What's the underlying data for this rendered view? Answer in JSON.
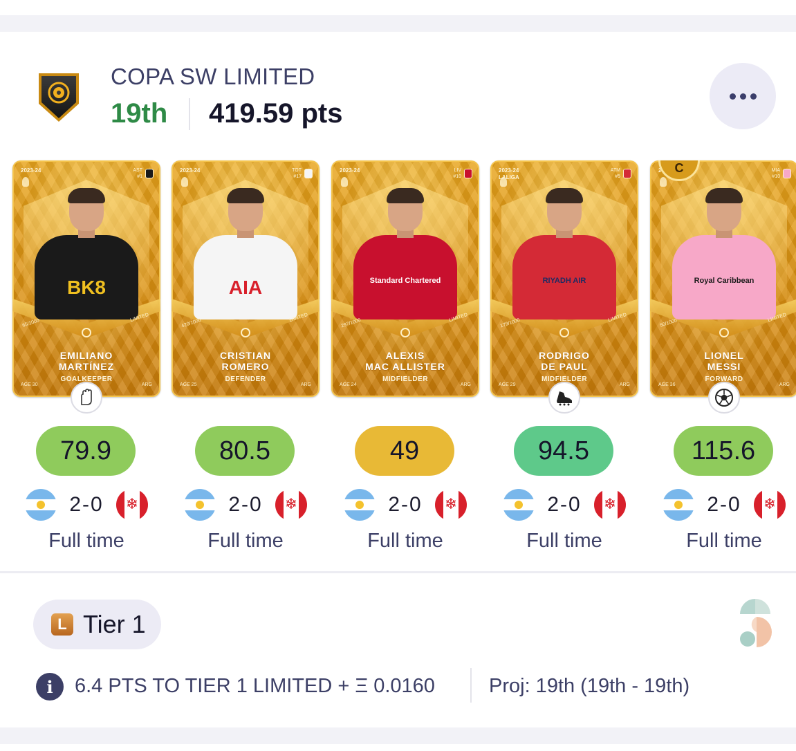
{
  "competition": {
    "title": "COPA SW LIMITED",
    "rank": "19th",
    "points": "419.59 pts",
    "more_icon": "ellipsis-icon"
  },
  "players": [
    {
      "season": "2023-24",
      "club_code": "AST",
      "club_number": "#1",
      "name_line1": "EMILIANO",
      "name_line2": "MARTÍNEZ",
      "position": "GOALKEEPER",
      "age": "AGE 30",
      "nationality": "ARG",
      "serial": "65/1000",
      "rarity": "LIMITED",
      "sponsor": "BK8",
      "shirt_color": "#1a1a1a",
      "sponsor_color": "#f0c020",
      "position_icon": "goalkeeper-gloves-icon",
      "captain": false,
      "score": "79.9",
      "score_color": "#8fcb5c",
      "home_score": "2",
      "away_score": "0",
      "status": "Full time"
    },
    {
      "season": "2023-24",
      "club_code": "TOT",
      "club_number": "#17",
      "name_line1": "CRISTIAN",
      "name_line2": "ROMERO",
      "position": "DEFENDER",
      "age": "AGE 25",
      "nationality": "ARG",
      "serial": "420/1000",
      "rarity": "LIMITED",
      "sponsor": "AIA",
      "shirt_color": "#f5f5f5",
      "sponsor_color": "#d8202b",
      "position_icon": "",
      "captain": false,
      "score": "80.5",
      "score_color": "#8fcb5c",
      "home_score": "2",
      "away_score": "0",
      "status": "Full time"
    },
    {
      "season": "2023-24",
      "club_code": "LIV",
      "club_number": "#10",
      "name_line1": "ALEXIS",
      "name_line2": "MAC ALLISTER",
      "position": "MIDFIELDER",
      "age": "AGE 24",
      "nationality": "ARG",
      "serial": "297/1000",
      "rarity": "LIMITED",
      "sponsor": "Standard Chartered",
      "shirt_color": "#c8102e",
      "sponsor_color": "#ffffff",
      "position_icon": "",
      "captain": false,
      "score": "49",
      "score_color": "#e8b936",
      "home_score": "2",
      "away_score": "0",
      "status": "Full time"
    },
    {
      "season": "2023-24",
      "league": "LALIGA",
      "club_code": "ATM",
      "club_number": "#5",
      "name_line1": "RODRIGO",
      "name_line2": "DE PAUL",
      "position": "MIDFIELDER",
      "age": "AGE 29",
      "nationality": "ARG",
      "serial": "179/1000",
      "rarity": "LIMITED",
      "sponsor": "RIYADH AIR",
      "shirt_color": "#d42a36",
      "sponsor_color": "#1d2b63",
      "position_icon": "football-boot-icon",
      "captain": false,
      "score": "94.5",
      "score_color": "#5ec98a",
      "home_score": "2",
      "away_score": "0",
      "status": "Full time"
    },
    {
      "season": "2023-24",
      "club_code": "MIA",
      "club_number": "#10",
      "name_line1": "LIONEL",
      "name_line2": "MESSI",
      "position": "FORWARD",
      "age": "AGE 36",
      "nationality": "ARG",
      "serial": "50/1000",
      "rarity": "LIMITED",
      "sponsor": "Royal Caribbean",
      "shirt_color": "#f7a8c8",
      "sponsor_color": "#1a1a1a",
      "position_icon": "soccer-ball-icon",
      "captain": true,
      "captain_label": "C",
      "score": "115.6",
      "score_color": "#8fcb5c",
      "home_score": "2",
      "away_score": "0",
      "status": "Full time"
    }
  ],
  "fixture": {
    "home_flag": "argentina-flag-icon",
    "away_flag": "canada-flag-icon",
    "separator": "-"
  },
  "tier": {
    "letter": "L",
    "label": "Tier 1"
  },
  "info": {
    "icon": "info-icon",
    "text": "6.4 PTS TO TIER 1 LIMITED + Ξ 0.0160",
    "projection": "Proj: 19th (19th - 19th)"
  }
}
